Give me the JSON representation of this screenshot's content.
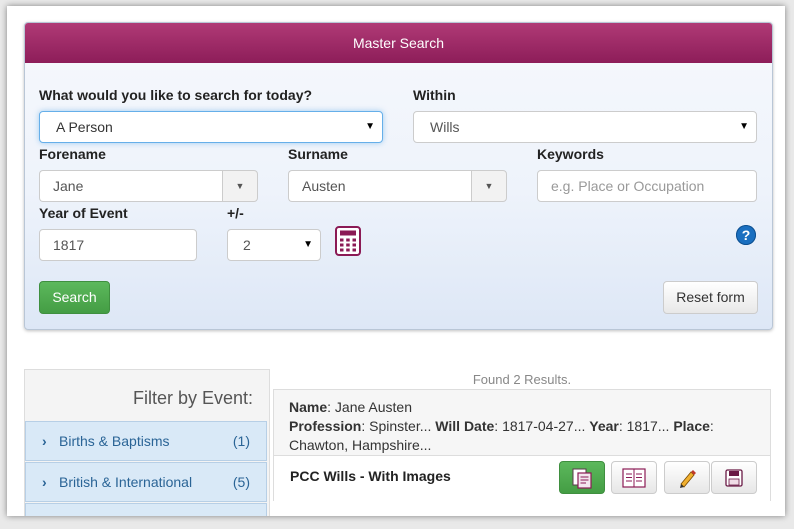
{
  "search": {
    "header": "Master Search",
    "question_label": "What would you like to search for today?",
    "question_value": "A Person",
    "within_label": "Within",
    "within_value": "Wills",
    "forename_label": "Forename",
    "forename_value": "Jane",
    "surname_label": "Surname",
    "surname_value": "Austen",
    "keywords_label": "Keywords",
    "keywords_placeholder": "e.g. Place or Occupation",
    "year_label": "Year of Event",
    "year_value": "1817",
    "range_label": "+/-",
    "range_value": "2",
    "search_button": "Search",
    "reset_button": "Reset form",
    "help_symbol": "?"
  },
  "filter": {
    "title": "Filter by Event:",
    "items": [
      {
        "label": "Births & Baptisms",
        "count": "(1)"
      },
      {
        "label": "British & International",
        "count": "(5)"
      }
    ]
  },
  "results": {
    "summary": "Found 2 Results.",
    "item": {
      "name_label": "Name",
      "name_value": ": Jane Austen",
      "profession_label": "Profession",
      "profession_value": ": Spinster...",
      "will_date_label": "Will Date",
      "will_date_value": ": 1817-04-27...",
      "year_label": "Year",
      "year_value": ": 1817...",
      "place_label": "Place",
      "place_value": ": Chawton, Hampshire...",
      "collection": "PCC Wills - With Images"
    }
  },
  "colors": {
    "header": "#9b2565",
    "accent_green": "#5cb85c",
    "link_blue": "#2a6496"
  },
  "icons": [
    "caret-down-icon",
    "calculator-icon",
    "help-icon",
    "chevron-right-icon",
    "view-document-icon",
    "transcript-icon",
    "pencil-icon",
    "save-icon"
  ]
}
